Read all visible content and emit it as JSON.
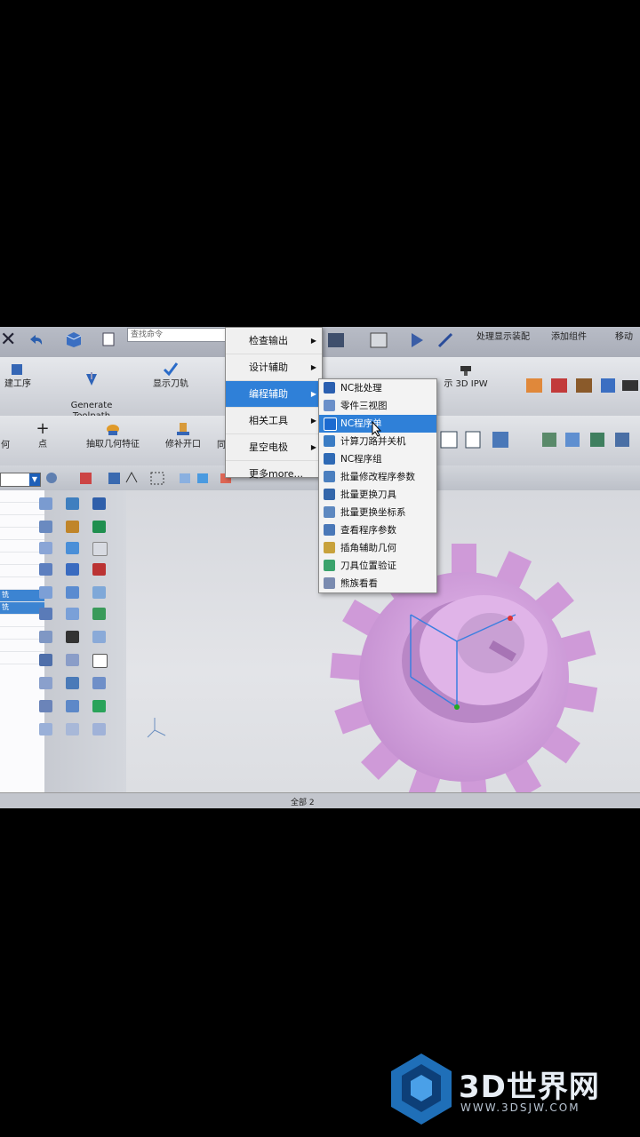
{
  "search": {
    "placeholder": "查找命令"
  },
  "topbar": {
    "right_items": [
      "处理显示装配",
      "添加组件",
      "移动"
    ]
  },
  "ribbon": {
    "row1": [
      {
        "label": "建工序"
      },
      {
        "label": "Generate\nToolpath"
      },
      {
        "label": "显示刀轨"
      },
      {
        "label": "示 3D IPW"
      }
    ],
    "row2": [
      {
        "label": "何"
      },
      {
        "label": "点"
      },
      {
        "label": "抽取几何特征"
      },
      {
        "label": "修补开口"
      },
      {
        "label": "同"
      }
    ]
  },
  "menu_main": {
    "items": [
      {
        "label": "检查输出",
        "has_sub": true
      },
      {
        "label": "设计辅助",
        "has_sub": true
      },
      {
        "label": "编程辅助",
        "has_sub": true,
        "active": true
      },
      {
        "label": "相关工具",
        "has_sub": true
      },
      {
        "label": "星空电极",
        "has_sub": true
      },
      {
        "label": "更多more...",
        "has_sub": false
      }
    ]
  },
  "menu_sub": {
    "items": [
      {
        "label": "NC批处理",
        "icon": "nc-batch-icon",
        "color": "#2a5fb0"
      },
      {
        "label": "零件三视图",
        "icon": "three-view-icon",
        "color": "#6a8fc9"
      },
      {
        "label": "NC程序单",
        "icon": "nc-sheet-icon",
        "color": "#1b6ad0",
        "highlighted": true
      },
      {
        "label": "计算刀路并关机",
        "icon": "compute-toolpath-icon",
        "color": "#3a7cc4"
      },
      {
        "label": "NC程序组",
        "icon": "nc-group-icon",
        "color": "#2f6ab5"
      },
      {
        "label": "批量修改程序参数",
        "icon": "batch-edit-icon",
        "color": "#4b7fbf"
      },
      {
        "label": "批量更换刀具",
        "icon": "batch-tool-icon",
        "color": "#3366aa"
      },
      {
        "label": "批量更换坐标系",
        "icon": "batch-csys-icon",
        "color": "#5d88c0"
      },
      {
        "label": "查看程序参数",
        "icon": "view-params-icon",
        "color": "#4a78b8"
      },
      {
        "label": "插角辅助几何",
        "icon": "corner-geom-icon",
        "color": "#c8a23c"
      },
      {
        "label": "刀具位置验证",
        "icon": "tool-verify-icon",
        "color": "#3aa36c"
      },
      {
        "label": "熊族看看",
        "icon": "bear-icon",
        "color": "#7a8bb0"
      }
    ]
  },
  "status": {
    "text": "全部 2"
  },
  "watermark": {
    "brand": "3D世界网",
    "url": "WWW.3DSJW.COM"
  },
  "colors": {
    "accent": "#2f80d8",
    "gear": "#d9a6e0"
  }
}
